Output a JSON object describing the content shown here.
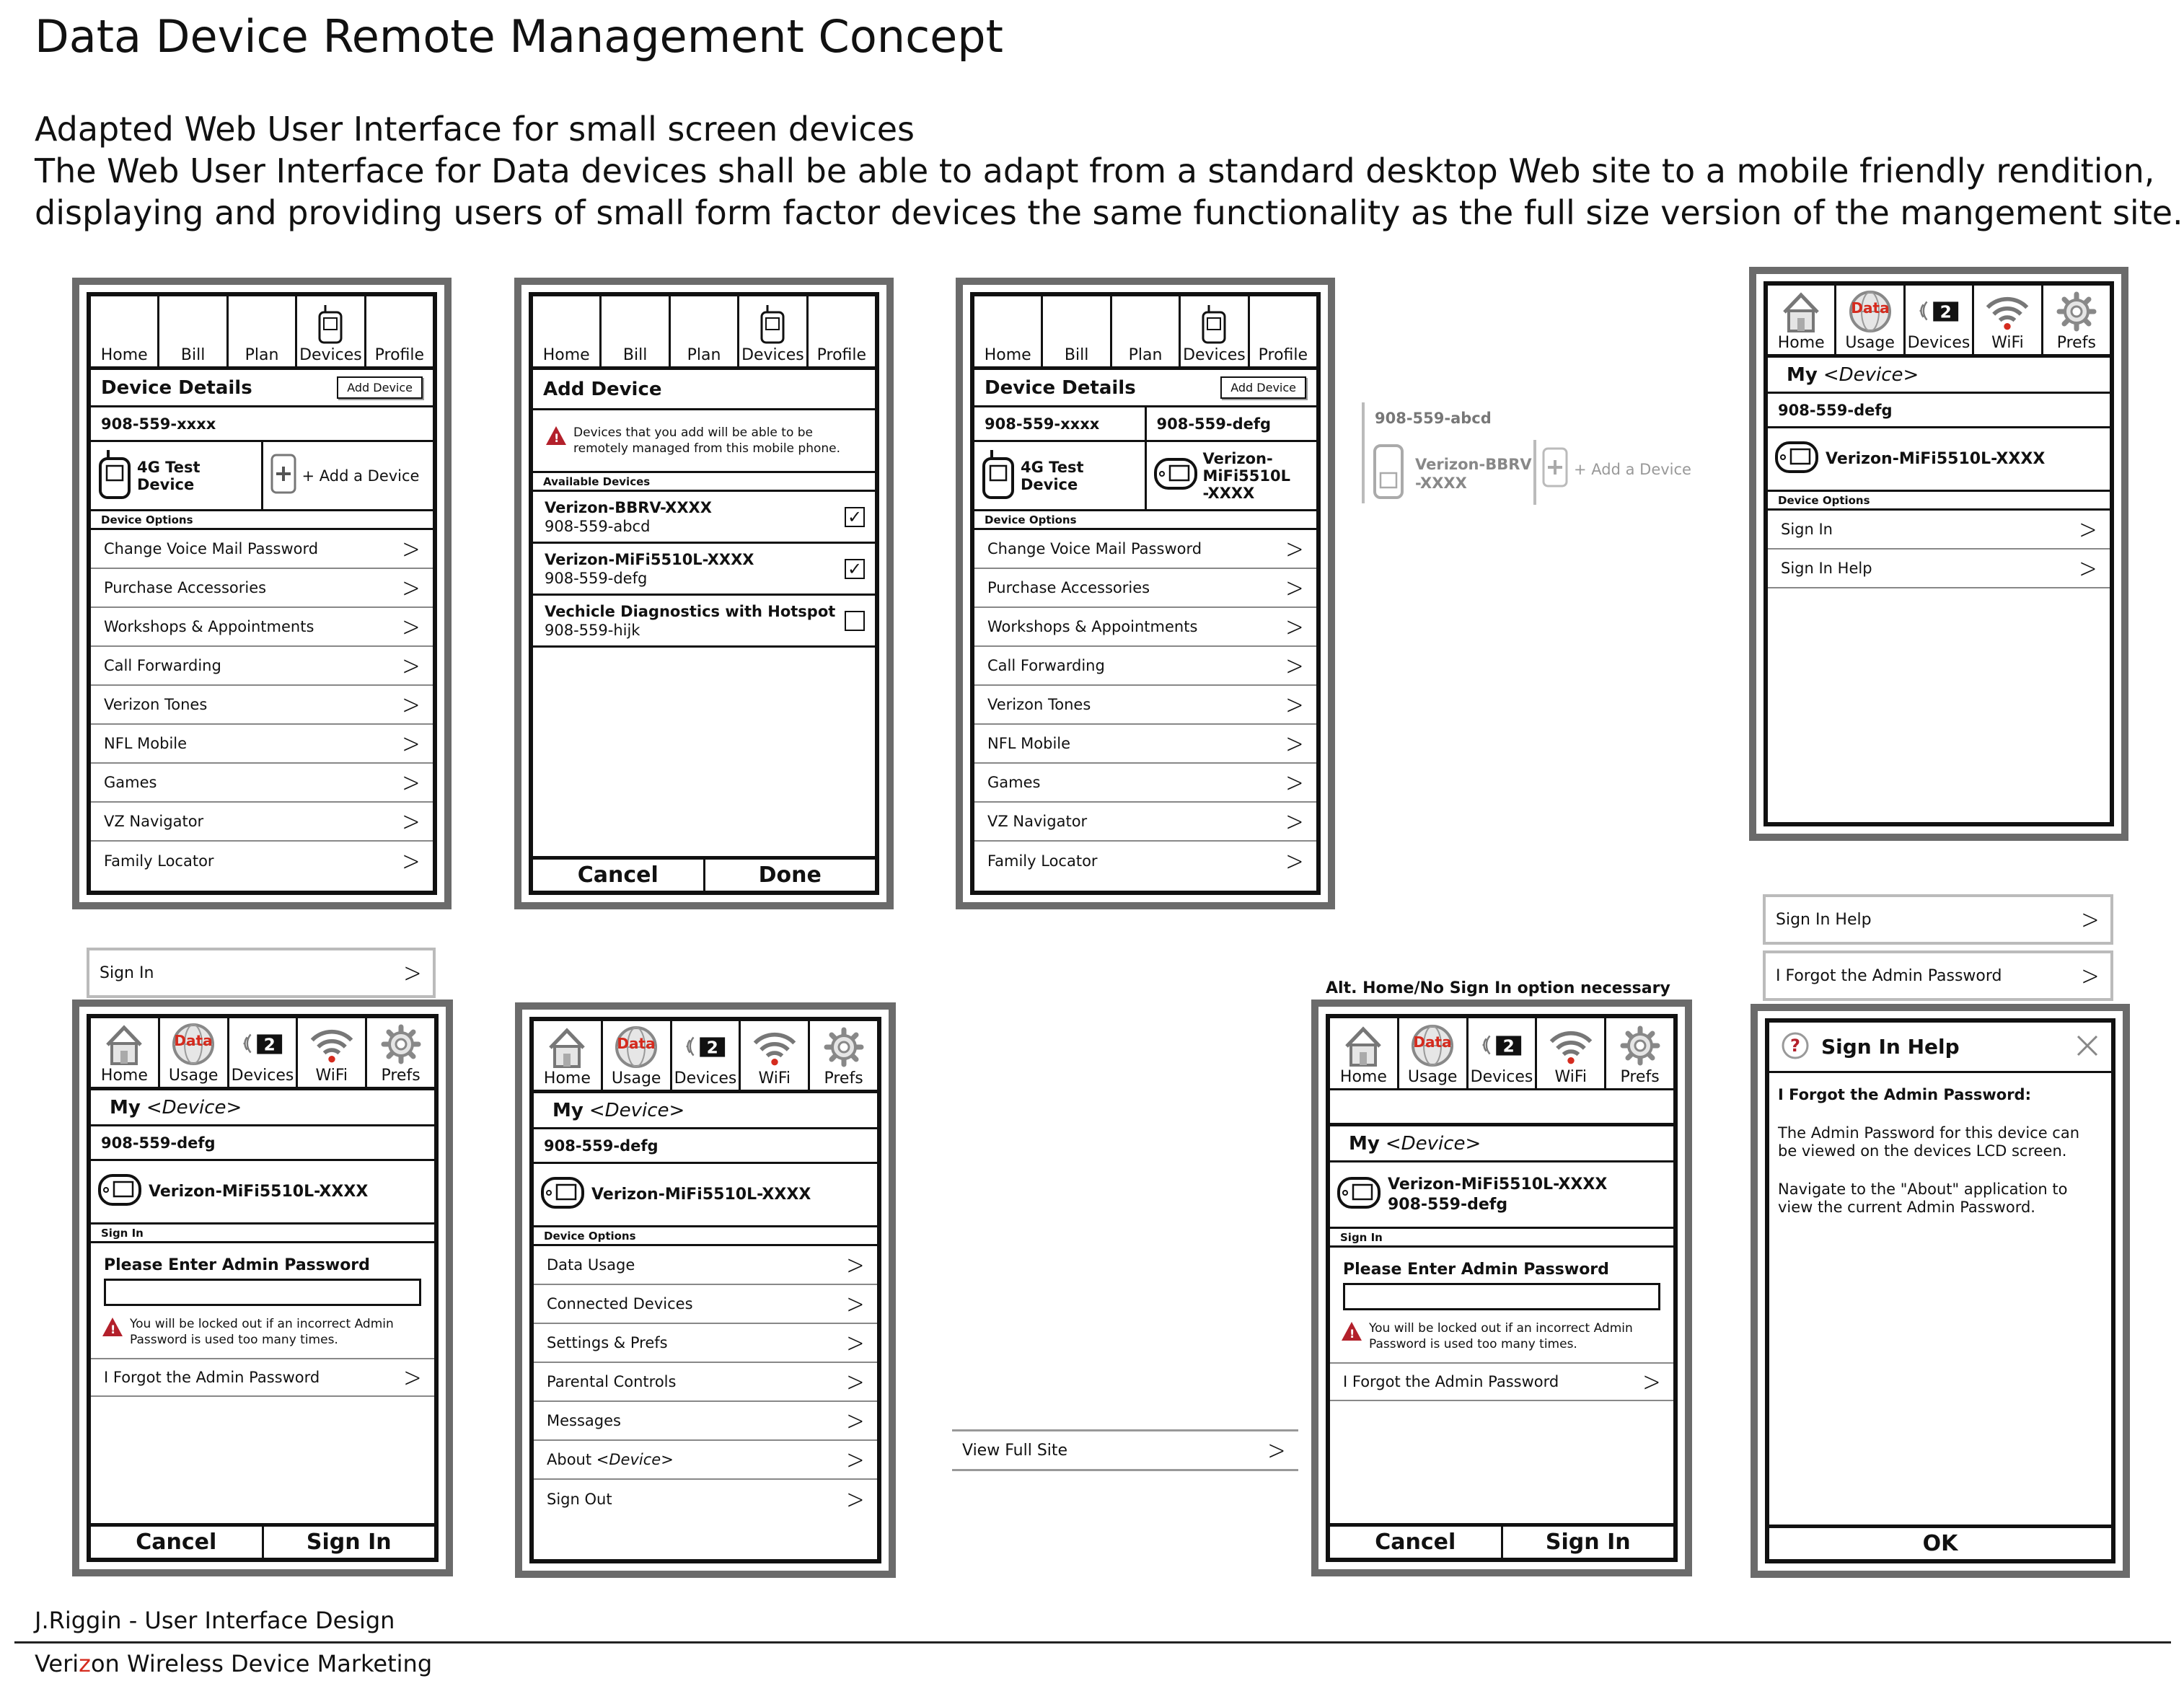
{
  "title": "Data Device Remote Management Concept",
  "subtitle": "Adapted Web User Interface for small screen devices",
  "description": [
    "The Web User Interface for Data devices shall be able to adapt from a standard desktop Web site to a mobile friendly rendition,",
    "displaying and providing users of small form factor devices the same functionality as the full size version of the mangement site."
  ],
  "credits": {
    "line1": "J.Riggin - User Interface Design",
    "line2_a": "Veri",
    "line2_b": "z",
    "line2_c": "on Wireless Device Marketing"
  },
  "nav_classic": [
    "Home",
    "Bill",
    "Plan",
    "Devices",
    "Profile"
  ],
  "nav_data": [
    "Home",
    "Usage",
    "Devices",
    "WiFi",
    "Prefs"
  ],
  "device_badge": "2",
  "data_icon_label": "Data",
  "device_details": {
    "title": "Device Details",
    "add_button": "Add Device",
    "number": "908-559-xxxx",
    "device_name": "4G Test Device",
    "add_device": "+ Add a Device",
    "options_label": "Device Options",
    "options": [
      "Change Voice Mail Password",
      "Purchase Accessories",
      "Workshops & Appointments",
      "Call Forwarding",
      "Verizon Tones",
      "NFL Mobile",
      "Games",
      "VZ Navigator",
      "Family Locator"
    ]
  },
  "add_device": {
    "title": "Add Device",
    "warning": "Devices that you add will be able to be remotely managed from this mobile phone.",
    "available_label": "Available Devices",
    "devices": [
      {
        "name": "Verizon-BBRV-XXXX",
        "number": "908-559-abcd",
        "checked": "✓"
      },
      {
        "name": "Verizon-MiFi5510L-XXXX",
        "number": "908-559-defg",
        "checked": "✓"
      },
      {
        "name": "Vechicle Diagnostics with Hotspot",
        "number": "908-559-hijk",
        "checked": ""
      }
    ],
    "cancel": "Cancel",
    "done": "Done"
  },
  "device_details_multi": {
    "num1": "908-559-xxxx",
    "num2": "908-559-defg",
    "num3": "908-559-abcd",
    "dev1": "4G Test Device",
    "dev2a": "Verizon-MiFi5510L",
    "dev2b": "-XXXX",
    "dev3a": "Verizon-BBRV",
    "dev3b": "-XXXX",
    "add": "+ Add a Device"
  },
  "my_device": {
    "my": "My",
    "device": "<Device>",
    "number": "908-559-defg",
    "name": "Verizon-MiFi5510L-XXXX",
    "options_label": "Device Options",
    "sign_in": "Sign In",
    "sign_in_help": "Sign In Help"
  },
  "sign_in": {
    "section": "Sign In",
    "label": "Please Enter Admin Password",
    "warning": "You will be locked out if an incorrect Admin Password is used too many times.",
    "forgot": "I Forgot the Admin Password",
    "cancel": "Cancel",
    "sign_in": "Sign In"
  },
  "data_options": {
    "options": [
      "Data Usage",
      "Connected Devices",
      "Settings & Prefs",
      "Parental Controls",
      "Messages",
      "About",
      "Sign Out"
    ],
    "about_device": "<Device>"
  },
  "view_full_site": "View Full Site",
  "alt_note": "Alt. Home/No Sign In option necessary",
  "help": {
    "float1": "Sign In Help",
    "float2": "I Forgot the Admin Password",
    "title": "Sign In Help",
    "heading": "I Forgot the Admin Password:",
    "p1": "The Admin Password for this device can be viewed on the devices LCD screen.",
    "p2": "Navigate to the \"About\" application to view the current Admin Password.",
    "ok": "OK"
  },
  "icons": {
    "home": "house-icon",
    "usage": "globe-icon",
    "devices": "signal-icon",
    "wifi": "wifi-icon",
    "prefs": "gear-icon",
    "phone": "phone-icon"
  },
  "colors": {
    "accent_red": "#d52b1e",
    "warning_red": "#b3202b",
    "frame_gray": "#6b6b6b"
  }
}
